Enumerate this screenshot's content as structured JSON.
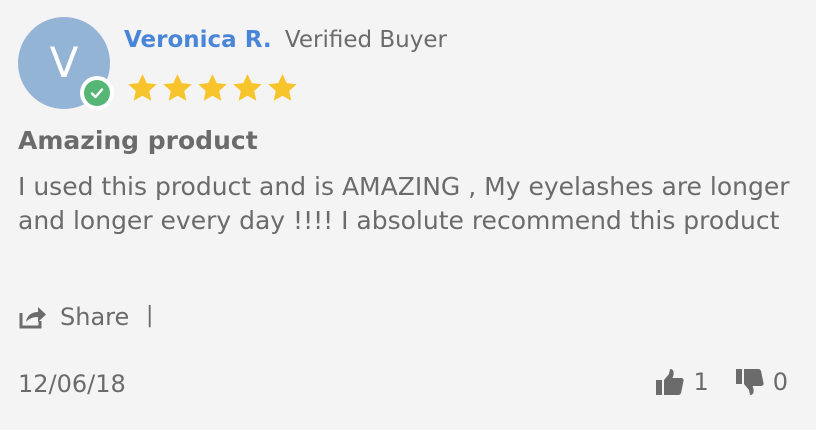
{
  "review": {
    "avatar_initial": "V",
    "reviewer_name": "Veronica R.",
    "verified_label": "Verified Buyer",
    "rating": 5,
    "rating_max": 5,
    "title": "Amazing product",
    "body": "I used this product and is AMAZING , My eyelashes are longer and longer every day !!!! I absolute recommend this product",
    "share_label": "Share",
    "separator": "|",
    "date": "12/06/18",
    "helpful_count": "1",
    "unhelpful_count": "0"
  },
  "colors": {
    "avatar_bg": "#94b4d6",
    "name": "#4a86d8",
    "star": "#f7c52b",
    "verified_badge": "#55b676",
    "text": "#6b6b6b"
  },
  "icons": {
    "verified": "check-circle-icon",
    "star": "star-icon",
    "share": "share-icon",
    "helpful": "thumbs-up-icon",
    "unhelpful": "thumbs-down-icon"
  }
}
